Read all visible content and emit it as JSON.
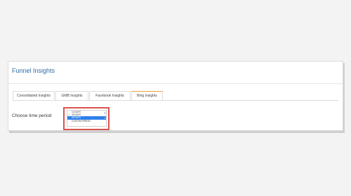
{
  "panel": {
    "title": "Funnel Insights"
  },
  "tabs": [
    {
      "label": "Consolidated Insights",
      "active": false
    },
    {
      "label": "GMB Insights",
      "active": false
    },
    {
      "label": "Facebook Insights",
      "active": false
    },
    {
      "label": "Bing Insights",
      "active": true
    }
  ],
  "time_period": {
    "label": "Choose time period",
    "options": [
      "14 DAYS",
      "30 DAYS",
      "90 DAYS",
      "CUSTOM PERIOD"
    ],
    "checked": "30 DAYS",
    "highlighted": "90 DAYS"
  },
  "colors": {
    "title": "#2e6da4",
    "active_tab_accent": "#e8a23a",
    "highlight_box": "#d9534f",
    "selected_option": "#2f80ed"
  }
}
